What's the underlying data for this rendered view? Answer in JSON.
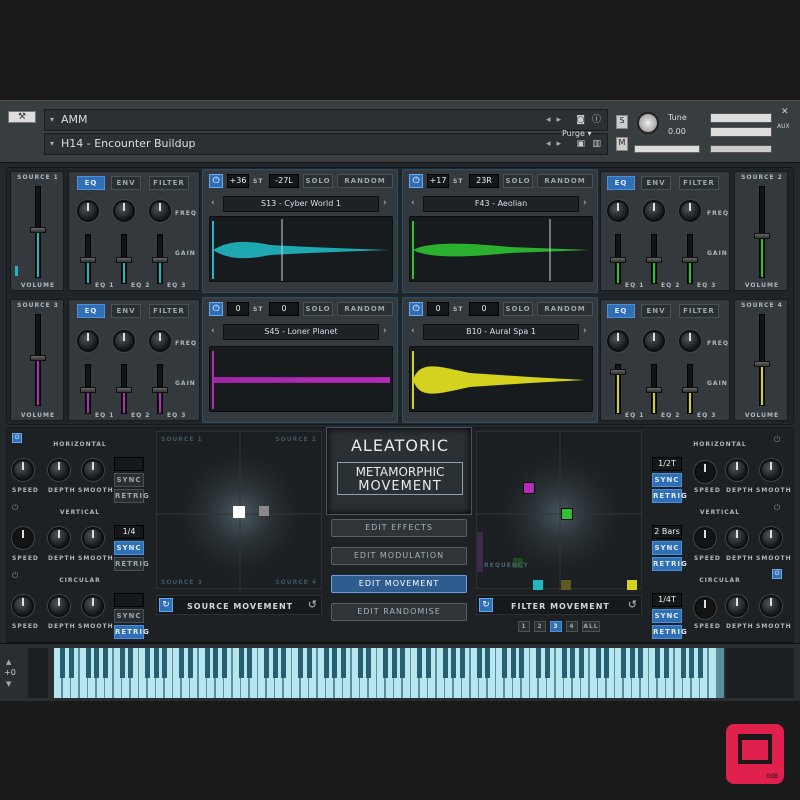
{
  "header": {
    "instrument_name": "AMM",
    "preset_name": "H14 - Encounter Buildup",
    "purge_label": "Purge",
    "tune_label": "Tune",
    "tune_value": "0.00",
    "s_label": "S",
    "m_label": "M",
    "aux_label": "AUX"
  },
  "sources": [
    {
      "label": "SOURCE 1",
      "color": "#1fb8c2",
      "sample": "S13 - Cyber World 1",
      "semitone": "+36",
      "st": "ST",
      "pan": "-27L"
    },
    {
      "label": "SOURCE 2",
      "color": "#2ec232",
      "sample": "F43 - Aeolian",
      "semitone": "+17",
      "st": "ST",
      "pan": "23R"
    },
    {
      "label": "SOURCE 3",
      "color": "#b62ab8",
      "sample": "S45 - Loner Planet",
      "semitone": "0",
      "st": "ST",
      "pan": "0"
    },
    {
      "label": "SOURCE 4",
      "color": "#d4d21e",
      "sample": "B10 - Aural Spa 1",
      "semitone": "0",
      "st": "ST",
      "pan": "0"
    }
  ],
  "labels": {
    "eq": "EQ",
    "env": "ENV",
    "filter": "FILTER",
    "solo": "SOLO",
    "random": "RANDOM",
    "freq": "FREQ",
    "gain": "GAIN",
    "eq1": "EQ 1",
    "eq2": "EQ 2",
    "eq3": "EQ 3",
    "volume": "VOLUME",
    "speed": "SPEED",
    "depth": "DEPTH",
    "smooth": "SMOOTH",
    "sync": "SYNC",
    "retrig": "RETRIG",
    "horizontal": "HORIZONTAL",
    "vertical": "VERTICAL",
    "circular": "CIRCULAR"
  },
  "left_lfo": {
    "vertical_rate": "1/4"
  },
  "right_lfo": {
    "horizontal_rate": "1/2T",
    "vertical_rate": "2 Bars",
    "circular_rate": "1/4T"
  },
  "xy_left": {
    "tl": "SOURCE 1",
    "tr": "SOURCE 2",
    "bl": "SOURCE 3",
    "br": "SOURCE 4",
    "title": "SOURCE MOVEMENT"
  },
  "xy_right": {
    "freq": "FREQUENCY",
    "res": "RESONANCE",
    "title": "FILTER MOVEMENT",
    "pages": [
      "1",
      "2",
      "3",
      "4",
      "ALL"
    ]
  },
  "logo": {
    "line1": "ALEATORIC",
    "line2": "METAMORPHIC",
    "line3": "MOVEMENT"
  },
  "menu": [
    "EDIT EFFECTS",
    "EDIT MODULATION",
    "EDIT MOVEMENT",
    "EDIT RANDOMISE"
  ],
  "keyboard": {
    "octave": "+0"
  },
  "badge": {
    "text": "0dB"
  }
}
